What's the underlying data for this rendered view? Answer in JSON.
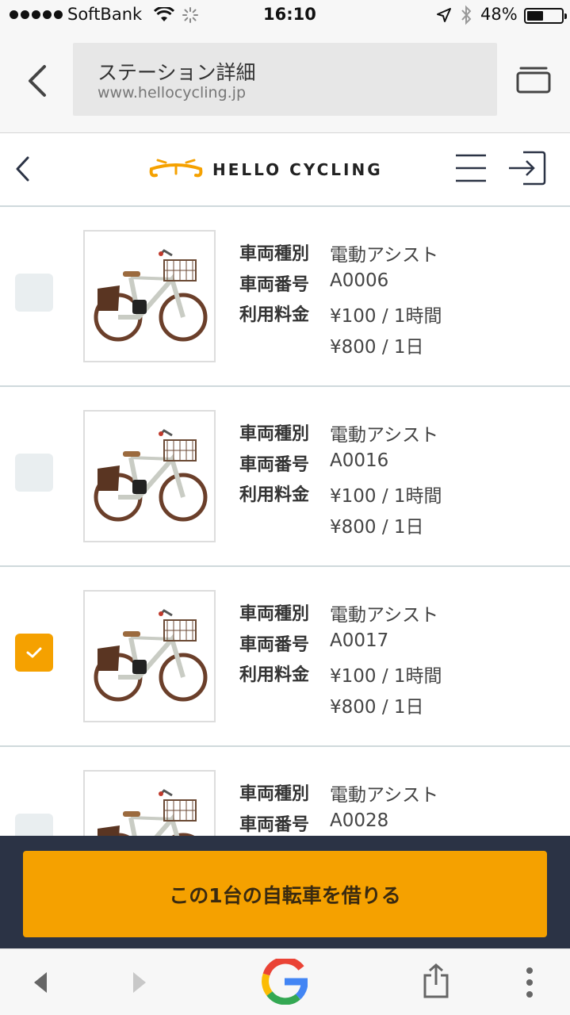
{
  "status": {
    "carrier": "SoftBank",
    "time": "16:10",
    "battery": "48%",
    "battery_level": 0.48
  },
  "browser": {
    "page_title": "ステーション詳細",
    "url": "www.hellocycling.jp"
  },
  "header": {
    "brand": "HELLO CYCLING",
    "brand_color": "#f5a100"
  },
  "labels": {
    "type": "車両種別",
    "number": "車両番号",
    "fee": "利用料金"
  },
  "bikes": [
    {
      "type": "電動アシスト",
      "number": "A0006",
      "fee1": "¥100 / 1時間",
      "fee2": "¥800 / 1日",
      "checked": false
    },
    {
      "type": "電動アシスト",
      "number": "A0016",
      "fee1": "¥100 / 1時間",
      "fee2": "¥800 / 1日",
      "checked": false
    },
    {
      "type": "電動アシスト",
      "number": "A0017",
      "fee1": "¥100 / 1時間",
      "fee2": "¥800 / 1日",
      "checked": true
    },
    {
      "type": "電動アシスト",
      "number": "A0028"
    }
  ],
  "cta": {
    "label": "この1台の自転車を借りる",
    "color": "#f5a100"
  },
  "bottom_nav": {
    "icons": [
      "back-icon",
      "forward-icon",
      "google-icon",
      "share-icon",
      "more-icon"
    ]
  }
}
